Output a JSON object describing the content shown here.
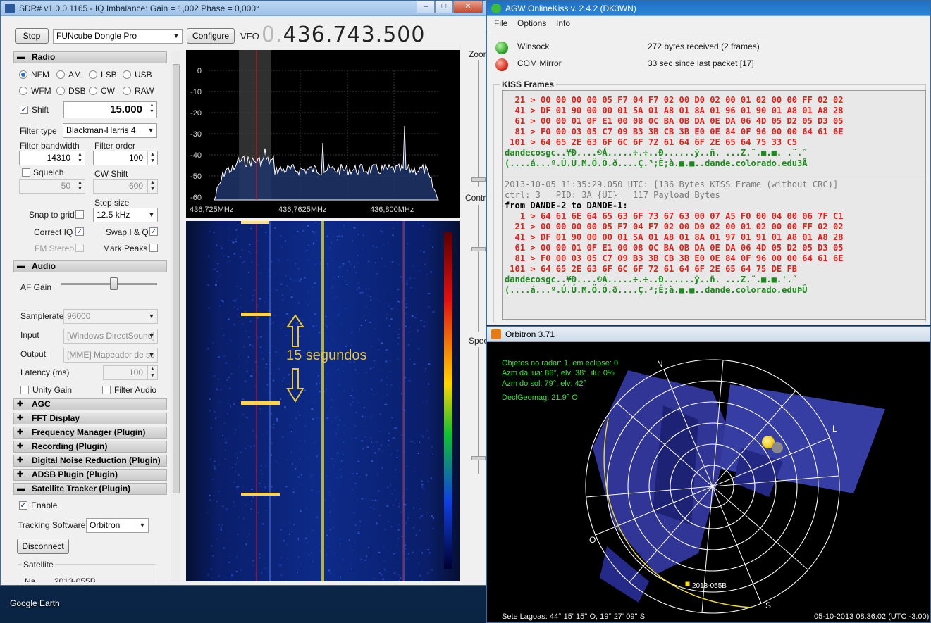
{
  "desktop": {
    "label": "Google Earth"
  },
  "sdr": {
    "title": "SDR# v1.0.0.1165 - IQ Imbalance: Gain = 1,002 Phase = 0,000°",
    "stop_label": "Stop",
    "device": "FUNcube Dongle Pro",
    "configure_label": "Configure",
    "vfo_label": "VFO",
    "vfo_lead": "0.",
    "vfo_value": "436.743.500",
    "radio": {
      "header": "Radio",
      "modes": [
        "NFM",
        "AM",
        "LSB",
        "USB",
        "WFM",
        "DSB",
        "CW",
        "RAW"
      ],
      "selected_mode": "NFM",
      "shift_label": "Shift",
      "shift_value": "15.000",
      "filter_type_label": "Filter type",
      "filter_type": "Blackman-Harris 4",
      "filter_bw_label": "Filter bandwidth",
      "filter_bw": "14310",
      "filter_order_label": "Filter order",
      "filter_order": "100",
      "squelch_label": "Squelch",
      "squelch_value": "50",
      "cw_shift_label": "CW Shift",
      "cw_shift_value": "600",
      "step_size_label": "Step size",
      "step_size": "12.5 kHz",
      "snap_label": "Snap to grid",
      "correct_iq_label": "Correct IQ",
      "swap_iq_label": "Swap I & Q",
      "fm_stereo_label": "FM Stereo",
      "mark_peaks_label": "Mark Peaks"
    },
    "audio": {
      "header": "Audio",
      "af_gain_label": "AF Gain",
      "samplerate_label": "Samplerate",
      "samplerate": "96000",
      "input_label": "Input",
      "input": "[Windows DirectSound]",
      "output_label": "Output",
      "output": "[MME] Mapeador de so",
      "latency_label": "Latency (ms)",
      "latency": "100",
      "unity_gain_label": "Unity Gain",
      "filter_audio_label": "Filter Audio"
    },
    "sections": [
      "AGC",
      "FFT Display",
      "Frequency Manager (Plugin)",
      "Recording (Plugin)",
      "Digital Noise Reduction (Plugin)",
      "ADSB Plugin (Plugin)",
      "Satellite Tracker (Plugin)"
    ],
    "tracker": {
      "enable_label": "Enable",
      "tracking_sw_label": "Tracking Software",
      "tracking_sw": "Orbitron",
      "disconnect_label": "Disconnect",
      "satellite_label": "Satellite",
      "partial_name": "Na",
      "partial_value": "2013-055B"
    },
    "fft": {
      "y_ticks": [
        "0",
        "-10",
        "-20",
        "-30",
        "-40",
        "-50",
        "-60"
      ],
      "x_ticks": [
        "436,725MHz",
        "436,7625MHz",
        "436,800MHz"
      ]
    },
    "waterfall_annotation": "15 segundos",
    "side_labels": [
      "Zoom",
      "Contr",
      "Spee"
    ]
  },
  "agw": {
    "title": "AGW OnlineKiss v. 2.4.2  (DK3WN)",
    "menu": [
      "File",
      "Options",
      "Info"
    ],
    "status": [
      {
        "name": "Winsock",
        "info": "272 bytes received (2 frames)",
        "color": "#2ea12a"
      },
      {
        "name": "COM Mirror",
        "info": "33 sec since last packet [17]",
        "color": "#d42a1a"
      }
    ],
    "kiss_title": "KISS Frames",
    "lines": [
      {
        "t": "hex",
        "s": "  21 > 00 00 00 00 05 F7 04 F7 02 00 D0 02 00 01 02 00 00 FF 02 02"
      },
      {
        "t": "hex",
        "s": "  41 > DF 01 90 00 00 01 5A 01 A8 01 8A 01 96 01 90 01 A8 01 A8 28"
      },
      {
        "t": "hex",
        "s": "  61 > 00 00 01 0F E1 00 08 0C BA 0B DA 0E DA 06 4D 05 D2 05 D3 05"
      },
      {
        "t": "hex",
        "s": "  81 > F0 00 03 05 C7 09 B3 3B CB 3B E0 0E 84 0F 96 00 00 64 61 6E"
      },
      {
        "t": "hex",
        "s": " 101 > 64 65 2E 63 6F 6C 6F 72 61 64 6F 2E 65 64 75 33 C5"
      },
      {
        "t": "asc",
        "s": "dandecosgc..¥Ð....®Á.....÷.÷..Ð......ÿ..ñ. ...Z.¨.■.■. .¨.˝"
      },
      {
        "t": "asc",
        "s": "(....á...º.Ú.Ú.M.Ö.Ó.ð....Ç.³;Ë;à.■.■..dande.colorado.edu3Å"
      },
      {
        "t": "blank",
        "s": ""
      },
      {
        "t": "gry",
        "s": "2013-10-05 11:35:29.050 UTC: [136 Bytes KISS Frame (without CRC)]"
      },
      {
        "t": "gry",
        "s": "ctrl: 3   PID: 3A {UI}   117 Payload Bytes"
      },
      {
        "t": "blk",
        "s": "from DANDE-2 to DANDE-1:"
      },
      {
        "t": "hex",
        "s": "   1 > 64 61 6E 64 65 63 6F 73 67 63 00 07 A5 F0 00 04 00 06 7F C1"
      },
      {
        "t": "hex",
        "s": "  21 > 00 00 00 00 05 F7 04 F7 02 00 D0 02 00 01 02 00 00 FF 02 02"
      },
      {
        "t": "hex",
        "s": "  41 > DF 01 90 00 00 01 5A 01 A8 01 8A 01 97 01 91 01 A8 01 A8 28"
      },
      {
        "t": "hex",
        "s": "  61 > 00 00 01 0F E1 00 08 0C BA 0B DA 0E DA 06 4D 05 D2 05 D3 05"
      },
      {
        "t": "hex",
        "s": "  81 > F0 00 03 05 C7 09 B3 3B CB 3B E0 0E 84 0F 96 00 00 64 61 6E"
      },
      {
        "t": "hex",
        "s": " 101 > 64 65 2E 63 6F 6C 6F 72 61 64 6F 2E 65 64 75 DE FB"
      },
      {
        "t": "asc",
        "s": "dandecosgc..¥Ð....®Á.....÷.÷..Ð......ÿ..ñ. ...Z.¨.■.■.'.˝"
      },
      {
        "t": "asc",
        "s": "(....á...º.Ú.Ú.M.Ö.Ó.ð....Ç.³;Ë;à.■.■..dande.colorado.eduÞÛ"
      }
    ]
  },
  "orbitron": {
    "title": "Orbitron 3.71",
    "info": [
      "Objetos no radar: 1, em eclipse: 0",
      "Azm da lua: 86°, elv: 38°, ilu: 0%",
      "Azm do sol: 79°, elv: 42°",
      "DeclGeomag: 21.9° O"
    ],
    "cardinals": {
      "n": "N",
      "l": "L",
      "s": "S",
      "o": "O"
    },
    "satellite_name": "2013-055B",
    "location": "Sete Lagoas: 44° 15' 15'' O, 19° 27' 09'' S",
    "datetime": "05-10-2013 08:36:02 (UTC -3:00)"
  }
}
